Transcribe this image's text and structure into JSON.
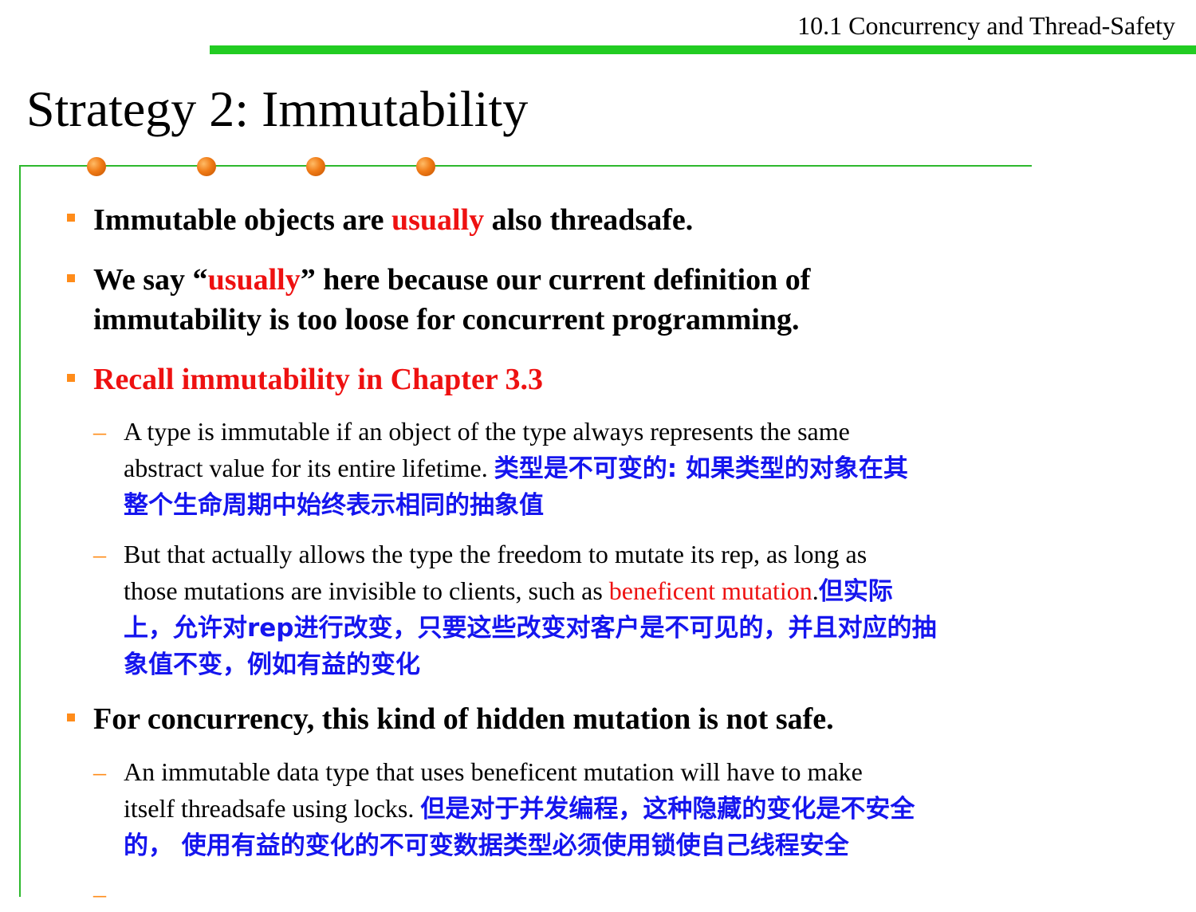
{
  "header": {
    "section": "10.1 Concurrency and Thread-Safety"
  },
  "slide": {
    "title": "Strategy 2: Immutability",
    "b1": {
      "pre": "Immutable objects are ",
      "red": "usually",
      "post": " also threadsafe."
    },
    "b2": {
      "pre": "We say “",
      "red": "usually",
      "post": "” here because our current definition of",
      "line2": "immutability is too loose for concurrent programming."
    },
    "b3": {
      "text": "Recall immutability in Chapter 3.3"
    },
    "s1": {
      "line1": "A type is immutable if an object of the type always represents the same",
      "line2_en": "abstract value for its entire lifetime. ",
      "line2_zh": "类型是不可变的: 如果类型的对象在其",
      "line3_zh": "整个生命周期中始终表示相同的抽象值"
    },
    "s2": {
      "line1": "But that actually allows the type the freedom to mutate its rep, as long as",
      "line2_en": "those mutations are invisible to clients, such as ",
      "line2_red": "beneficent mutation",
      "line2_dot": ".",
      "line2_zh": "但实际",
      "line3_zh": "上，允许对rep进行改变，只要这些改变对客户是不可见的，并且对应的抽",
      "line4_zh": "象值不变，例如有益的变化"
    },
    "b4": {
      "text": "For concurrency, this kind of hidden mutation is not safe."
    },
    "s3": {
      "line1": "An immutable data type that uses beneficent mutation will have to make",
      "line2_en": "itself threadsafe using locks. ",
      "line2_zh": "但是对于并发编程，这种隐藏的变化是不安全",
      "line3_zh": "的， 使用有益的变化的不可变数据类型必须使用锁使自己线程安全"
    },
    "s4": {
      "dash": "–"
    }
  },
  "colors": {
    "accent_green": "#22cc22",
    "bullet_orange": "#ff8c1a",
    "highlight_red": "#ee1111",
    "chinese_blue": "#1515ee"
  }
}
